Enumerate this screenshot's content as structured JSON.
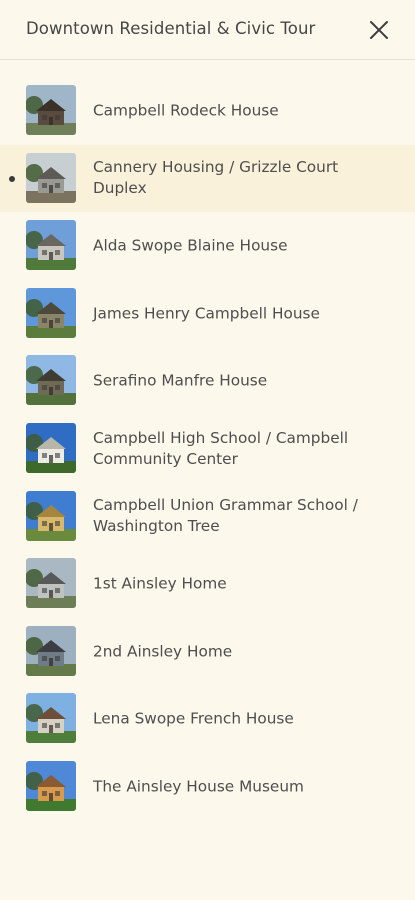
{
  "header": {
    "title": "Downtown Residential & Civic Tour",
    "close_icon": "close-icon"
  },
  "tour": {
    "active_index": 1,
    "stops": [
      {
        "label": "Campbell Rodeck House",
        "sky": "#9fb6c9",
        "house": "#5b4a3e",
        "roof": "#3a3129",
        "ground": "#6f7f5a"
      },
      {
        "label": "Cannery Housing / Grizzle Court Duplex",
        "sky": "#c8cfd2",
        "house": "#9a9a94",
        "roof": "#5e5a55",
        "ground": "#7b7360"
      },
      {
        "label": "Alda Swope Blaine House",
        "sky": "#6f9fd8",
        "house": "#c9c6bd",
        "roof": "#6a6660",
        "ground": "#4f7a3b"
      },
      {
        "label": "James Henry Campbell House",
        "sky": "#5f97db",
        "house": "#8a8468",
        "roof": "#4d4a3b",
        "ground": "#5b7c3c"
      },
      {
        "label": "Serafino Manfre House",
        "sky": "#8fb8e4",
        "house": "#6e6a55",
        "roof": "#3f3d33",
        "ground": "#53713a"
      },
      {
        "label": "Campbell High School / Campbell Community Center",
        "sky": "#2f6cc4",
        "house": "#ecebe4",
        "roof": "#b8b5aa",
        "ground": "#3d6a2b"
      },
      {
        "label": "Campbell Union Grammar School / Washington Tree",
        "sky": "#3f7dd1",
        "house": "#d8b86a",
        "roof": "#a6863f",
        "ground": "#6a8a3e"
      },
      {
        "label": "1st Ainsley Home",
        "sky": "#a9b8c2",
        "house": "#bfc2c0",
        "roof": "#585a59",
        "ground": "#6d7d55"
      },
      {
        "label": "2nd Ainsley Home",
        "sky": "#9db0bf",
        "house": "#6f7c86",
        "roof": "#3b3f44",
        "ground": "#647a48"
      },
      {
        "label": "Lena Swope French House",
        "sky": "#7eb0e2",
        "house": "#d7d1c3",
        "roof": "#6b4f3a",
        "ground": "#4f7d3a"
      },
      {
        "label": "The Ainsley House Museum",
        "sky": "#4f88d6",
        "house": "#d89a4c",
        "roof": "#8a5a33",
        "ground": "#3f7a2f"
      }
    ]
  }
}
